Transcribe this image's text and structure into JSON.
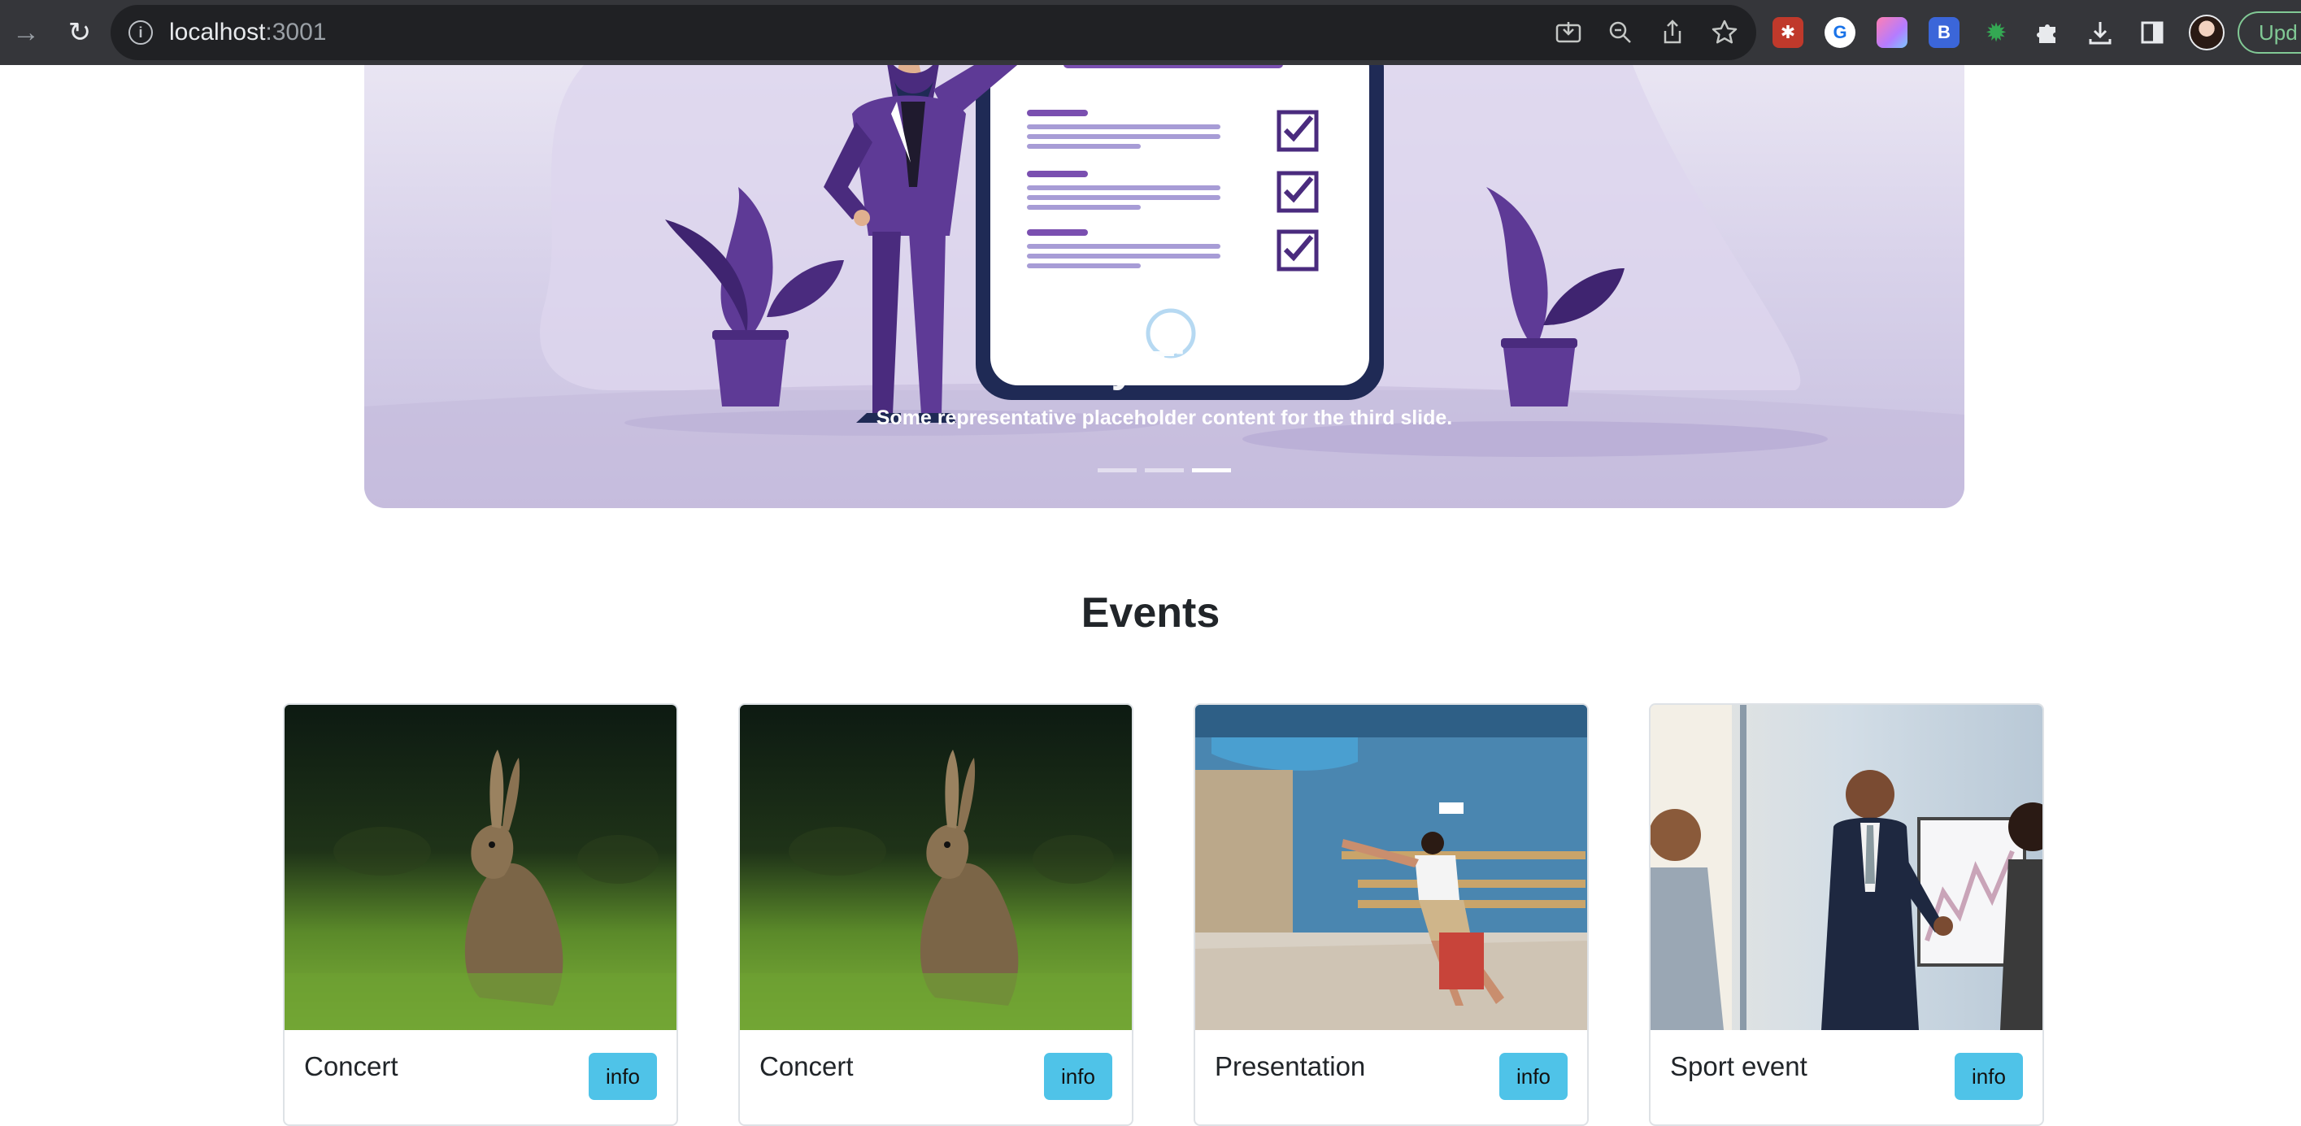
{
  "browser": {
    "url_host": "localhost",
    "url_port": ":3001",
    "update_label": "Upd"
  },
  "carousel": {
    "slide_title": "Day Ticket",
    "slide_caption": "Some representative placeholder content for the third slide.",
    "active_index": 2,
    "slide_count": 3
  },
  "events": {
    "heading": "Events",
    "cards": [
      {
        "title": "Concert",
        "button": "info",
        "image": "rabbit-photo"
      },
      {
        "title": "Concert",
        "button": "info",
        "image": "rabbit-photo"
      },
      {
        "title": "Presentation",
        "button": "info",
        "image": "woman-with-suitcase-photo"
      },
      {
        "title": "Sport event",
        "button": "info",
        "image": "business-presentation-photo"
      }
    ]
  }
}
